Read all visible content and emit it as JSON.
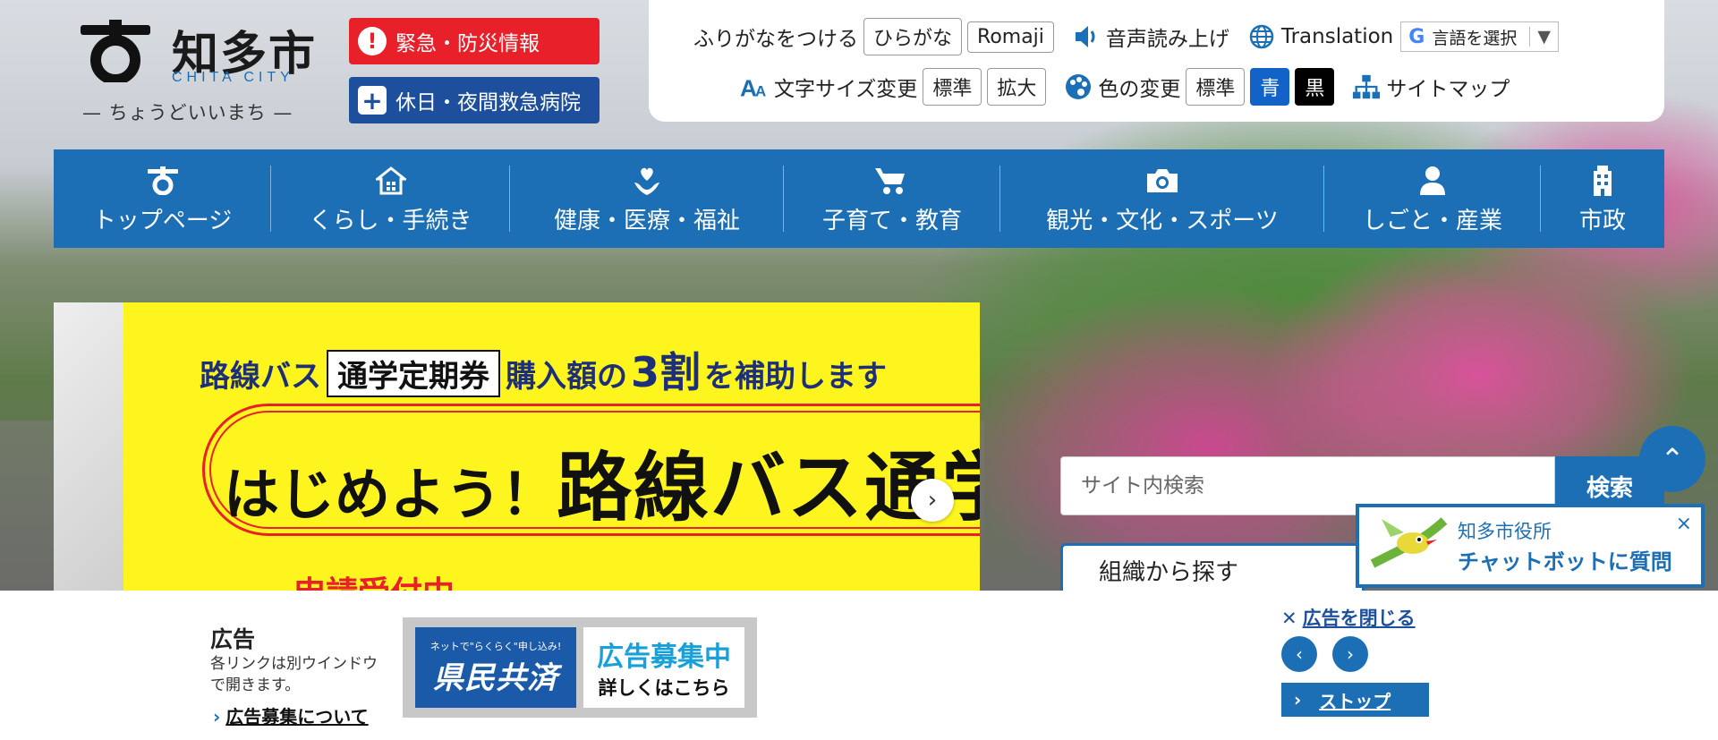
{
  "header": {
    "logo_name": "知多市",
    "logo_en": "CHITA CITY",
    "logo_sub": "— ちょうどいいまち —",
    "emergency_label": "緊急・防災情報",
    "hospital_label": "休日・夜間救急病院"
  },
  "utility": {
    "furigana_label": "ふりがなをつける",
    "hiragana_btn": "ひらがな",
    "romaji_btn": "Romaji",
    "voice_label": "音声読み上げ",
    "translation_label": "Translation",
    "language_select": "言語を選択",
    "font_size_label": "文字サイズ変更",
    "font_standard": "標準",
    "font_large": "拡大",
    "color_label": "色の変更",
    "color_standard": "標準",
    "color_blue": "青",
    "color_black": "黒",
    "sitemap_label": "サイトマップ"
  },
  "nav": {
    "items": [
      {
        "label": "トップページ",
        "icon": "city-emblem-icon"
      },
      {
        "label": "くらし・手続き",
        "icon": "house-icon"
      },
      {
        "label": "健康・医療・福祉",
        "icon": "heart-hand-icon"
      },
      {
        "label": "子育て・教育",
        "icon": "stroller-icon"
      },
      {
        "label": "観光・文化・スポーツ",
        "icon": "camera-icon"
      },
      {
        "label": "しごと・産業",
        "icon": "person-icon"
      },
      {
        "label": "市政",
        "icon": "building-icon"
      }
    ]
  },
  "banner": {
    "line1_a": "路線バス",
    "line1_box": "通学定期券",
    "line1_b": "購入額の",
    "line1_num": "3割",
    "line1_c": "を補助します",
    "line2_a": "はじめよう！",
    "line2_b": "路線バス通学",
    "line3": "申請受付中"
  },
  "search": {
    "placeholder": "サイト内検索",
    "button": "検索"
  },
  "org_search": "組織から探す",
  "chatbot": {
    "line1": "知多市役所",
    "line2": "チャットボットに質問",
    "close": "×"
  },
  "ad": {
    "title": "広告",
    "note": "各リンクは別ウインドウで開きます。",
    "recruit_link": "広告募集について",
    "ad1_small": "ネットで\"らくらく\"申し込み!",
    "ad1_big": "県民共済",
    "ad2_big": "広告募集中",
    "ad2_small": "詳しくはこちら",
    "close_label": "広告を閉じる",
    "stop_label": "ストップ"
  },
  "colors": {
    "brand_blue": "#1d6fb5",
    "emergency_red": "#e8202a",
    "hospital_navy": "#1d4f9d",
    "banner_yellow": "#fff51e"
  }
}
